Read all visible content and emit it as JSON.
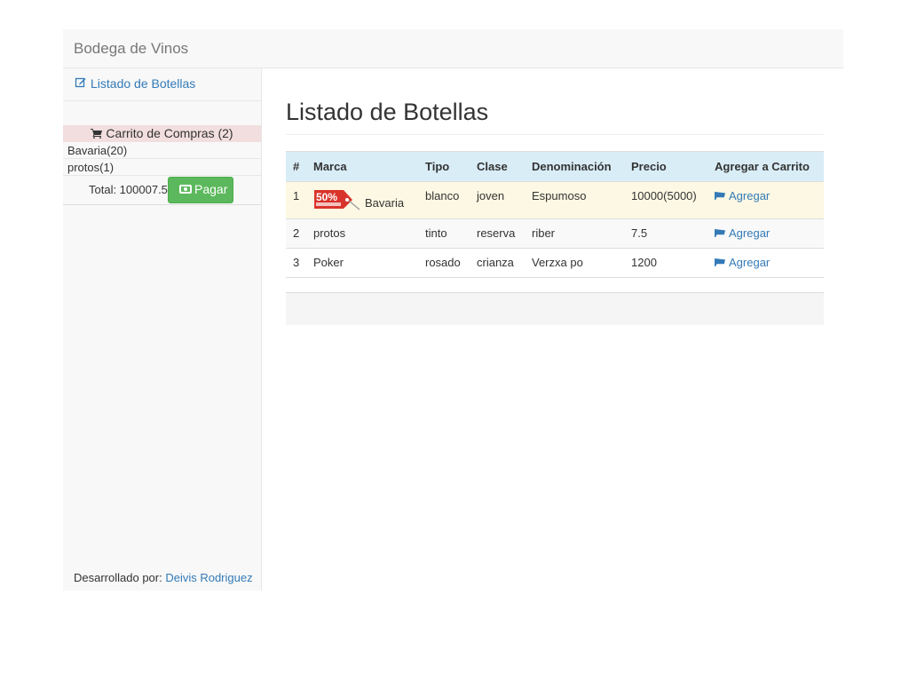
{
  "navbar": {
    "brand": "Bodega de Vinos"
  },
  "sidebar": {
    "link_label": "Listado de Botellas",
    "cart_title": "Carrito de Compras (2)",
    "cart_items": [
      "Bavaria(20)",
      "protos(1)"
    ],
    "total_label": "Total: 100007.5",
    "pay_label": "Pagar",
    "footer_prefix": "Desarrollado por: ",
    "footer_author": "Deivis Rodriguez"
  },
  "main": {
    "title": "Listado de Botellas",
    "columns": [
      "#",
      "Marca",
      "Tipo",
      "Clase",
      "Denominación",
      "Precio",
      "Agregar a Carrito"
    ],
    "rows": [
      {
        "num": "1",
        "marca": "Bavaria",
        "tipo": "blanco",
        "clase": "joven",
        "denominacion": "Espumoso",
        "precio": "10000(5000)",
        "action": "Agregar",
        "badge": "50%"
      },
      {
        "num": "2",
        "marca": "protos",
        "tipo": "tinto",
        "clase": "reserva",
        "denominacion": "riber",
        "precio": "7.5",
        "action": "Agregar"
      },
      {
        "num": "3",
        "marca": "Poker",
        "tipo": "rosado",
        "clase": "crianza",
        "denominacion": "Verzxa po",
        "precio": "1200",
        "action": "Agregar"
      }
    ]
  },
  "colors": {
    "link": "#337ab7",
    "success": "#5cb85c",
    "info_header": "#d9edf7",
    "warning_row": "#fcf8e3",
    "danger_head": "#f2dede"
  },
  "icons": {
    "edit": "edit-icon",
    "cart": "cart-icon",
    "money": "money-icon"
  }
}
